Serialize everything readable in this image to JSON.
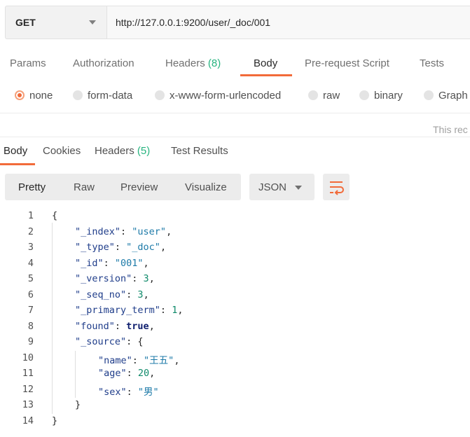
{
  "request": {
    "method": "GET",
    "url": "http://127.0.0.1:9200/user/_doc/001"
  },
  "request_tabs": [
    {
      "label": "Params",
      "count": ""
    },
    {
      "label": "Authorization",
      "count": ""
    },
    {
      "label": "Headers",
      "count": "(8)"
    },
    {
      "label": "Body",
      "count": ""
    },
    {
      "label": "Pre-request Script",
      "count": ""
    },
    {
      "label": "Tests",
      "count": ""
    }
  ],
  "active_request_tab": "Body",
  "body_types": [
    "none",
    "form-data",
    "x-www-form-urlencoded",
    "raw",
    "binary",
    "Graph"
  ],
  "selected_body_type": "none",
  "truncated_note": "This rec",
  "response_tabs": [
    {
      "label": "Body",
      "count": ""
    },
    {
      "label": "Cookies",
      "count": ""
    },
    {
      "label": "Headers",
      "count": "(5)"
    },
    {
      "label": "Test Results",
      "count": ""
    }
  ],
  "active_response_tab": "Body",
  "view_modes": [
    "Pretty",
    "Raw",
    "Preview",
    "Visualize"
  ],
  "active_view_mode": "Pretty",
  "format": "JSON",
  "response_lines": [
    {
      "n": "1",
      "text": "{"
    },
    {
      "n": "2",
      "key": "\"_index\"",
      "value": "\"user\"",
      "vtype": "str",
      "trail": ","
    },
    {
      "n": "3",
      "key": "\"_type\"",
      "value": "\"_doc\"",
      "vtype": "str",
      "trail": ","
    },
    {
      "n": "4",
      "key": "\"_id\"",
      "value": "\"001\"",
      "vtype": "str",
      "trail": ","
    },
    {
      "n": "5",
      "key": "\"_version\"",
      "value": "3",
      "vtype": "num",
      "trail": ","
    },
    {
      "n": "6",
      "key": "\"_seq_no\"",
      "value": "3",
      "vtype": "num",
      "trail": ","
    },
    {
      "n": "7",
      "key": "\"_primary_term\"",
      "value": "1",
      "vtype": "num",
      "trail": ","
    },
    {
      "n": "8",
      "key": "\"found\"",
      "value": "true",
      "vtype": "bool",
      "trail": ","
    },
    {
      "n": "9",
      "key": "\"_source\"",
      "value": "{",
      "vtype": "punc",
      "trail": ""
    },
    {
      "n": "10",
      "key": "\"name\"",
      "value": "\"王五\"",
      "vtype": "str",
      "trail": ","
    },
    {
      "n": "11",
      "key": "\"age\"",
      "value": "20",
      "vtype": "num",
      "trail": ","
    },
    {
      "n": "12",
      "key": "\"sex\"",
      "value": "\"男\"",
      "vtype": "str",
      "trail": ""
    },
    {
      "n": "13",
      "text": "}"
    },
    {
      "n": "14",
      "text": "}"
    }
  ],
  "colors": {
    "accent": "#f26b3a",
    "count_green": "#26b47f",
    "json_key": "#1f3d8a",
    "json_string": "#1d7aa8",
    "json_number": "#0f8a6a"
  },
  "icons": {
    "method_dropdown": "chevron-down-icon",
    "format_dropdown": "chevron-down-icon",
    "wrap": "wrap-lines-icon"
  }
}
